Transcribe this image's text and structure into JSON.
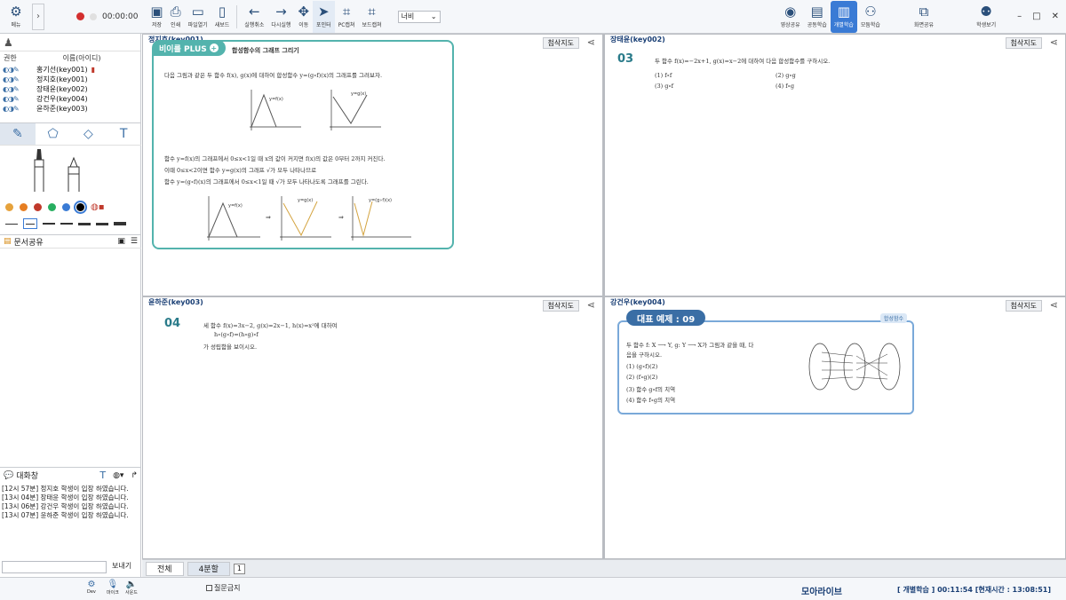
{
  "toolbar": {
    "menu_label": "메뉴",
    "timer": "00:00:00",
    "buttons": [
      {
        "label": "저장",
        "icon": "save-icon"
      },
      {
        "label": "인쇄",
        "icon": "print-icon"
      },
      {
        "label": "파일열기",
        "icon": "folder-open-icon"
      },
      {
        "label": "새보드",
        "icon": "new-board-icon"
      },
      {
        "label": "실행취소",
        "icon": "undo-icon"
      },
      {
        "label": "다시실행",
        "icon": "redo-icon"
      },
      {
        "label": "이동",
        "icon": "move-icon"
      },
      {
        "label": "포인터",
        "icon": "pointer-icon"
      },
      {
        "label": "PC캡쳐",
        "icon": "pc-capture-icon"
      },
      {
        "label": "보드캡쳐",
        "icon": "board-capture-icon"
      }
    ],
    "zoom_select": "너비",
    "right_buttons": [
      {
        "label": "영상공유",
        "icon": "video-share-icon"
      },
      {
        "label": "공동학습",
        "icon": "co-learning-icon"
      },
      {
        "label": "개별학습",
        "icon": "individual-learning-icon"
      },
      {
        "label": "모둠학습",
        "icon": "group-learning-icon"
      },
      {
        "label": "화면공유",
        "icon": "screen-share-icon"
      },
      {
        "label": "학생보기",
        "icon": "add-student-icon"
      }
    ]
  },
  "sidebar": {
    "col_permission": "권한",
    "col_name": "이름(아이디)",
    "users": [
      "홍기선(key001)",
      "정지호(key001)",
      "장태윤(key002)",
      "강건우(key004)",
      "윤하준(key003)"
    ],
    "doc_share_label": "문서공유",
    "chat_label": "대화창",
    "chat_messages": [
      "[12시 57분] 정지호 학생이 입장 하였습니다.",
      "[13시 04분] 장태윤 학생이 입장 하였습니다.",
      "[13시 06분] 강건우 학생이 입장 하였습니다.",
      "[13시 07분] 윤하준 학생이 입장 하였습니다."
    ],
    "send_label": "보내기",
    "colors": [
      "#e6a23c",
      "#e67e22",
      "#c0392b",
      "#27ae60",
      "#3a7bd5",
      "#000000"
    ]
  },
  "panes": [
    {
      "title": "정지호(key001)",
      "action": "첨삭지도",
      "badge": "비이를 PLUS",
      "heading": "합성함수의 그래프 그리기",
      "lines": [
        "다음 그림과 같은 두 함수 f(x), g(x)에 대하여 합성함수 y=(g∘f)(x)의 그래프를 그려보자.",
        "함수 y=f(x)의 그래프에서 0≤x<1일 때 x의 값이 커지면 f(x)의 값은 0부터 2까지 커진다.",
        "이때 0≤x<2이면 함수 y=g(x)의 그래프 √가 모두 나타나므로",
        "함수 y=(g∘f)(x)의 그래프에서 0≤x<1일 때 √가 모두 나타나도록 그래프를 그린다."
      ],
      "graph_labels": [
        "y=f(x)",
        "y=g(x)",
        "y=f(x)",
        "y=g(x)",
        "y=(g∘f)(x)"
      ]
    },
    {
      "title": "장태윤(key002)",
      "action": "첨삭지도",
      "number": "03",
      "question": "두 함수 f(x)=−2x+1, g(x)=x−2에 대하여 다음 합성함수를 구하시오.",
      "items": [
        "(1) f∘f",
        "(2) g∘g",
        "(3) g∘f",
        "(4) f∘g"
      ]
    },
    {
      "title": "윤하준(key003)",
      "action": "첨삭지도",
      "number": "04",
      "question": "세 함수 f(x)=3x−2, g(x)=2x−1, h(x)=x²에 대하여",
      "line2": "h∘(g∘f)=(h∘g)∘f",
      "line3": "가 성립함을 보이시오."
    },
    {
      "title": "강건우(key004)",
      "action": "첨삭지도",
      "badge": "대표 예제 : 09",
      "tag": "합성함수",
      "question": "두 함수 f: X ⟶ Y, g: Y ⟶ X가 그림과 같을 때, 다",
      "question2": "음을 구하시오.",
      "items": [
        "(1) (g∘f)(2)",
        "(2) (f∘g)(2)",
        "(3) 함수 g∘f의 치역",
        "(4) 함수 f∘g의 치역"
      ]
    }
  ],
  "bottom": {
    "tab_all": "전체",
    "tab_split": "4분할",
    "page": "1",
    "question_block": "질문금지",
    "brand": "모아라이브",
    "status": "[ 개별학습 ] 00:11:54 [현재시간 : 13:08:51]",
    "dev_label": "Dev",
    "mic_label": "마이크",
    "speaker_label": "사운드"
  }
}
